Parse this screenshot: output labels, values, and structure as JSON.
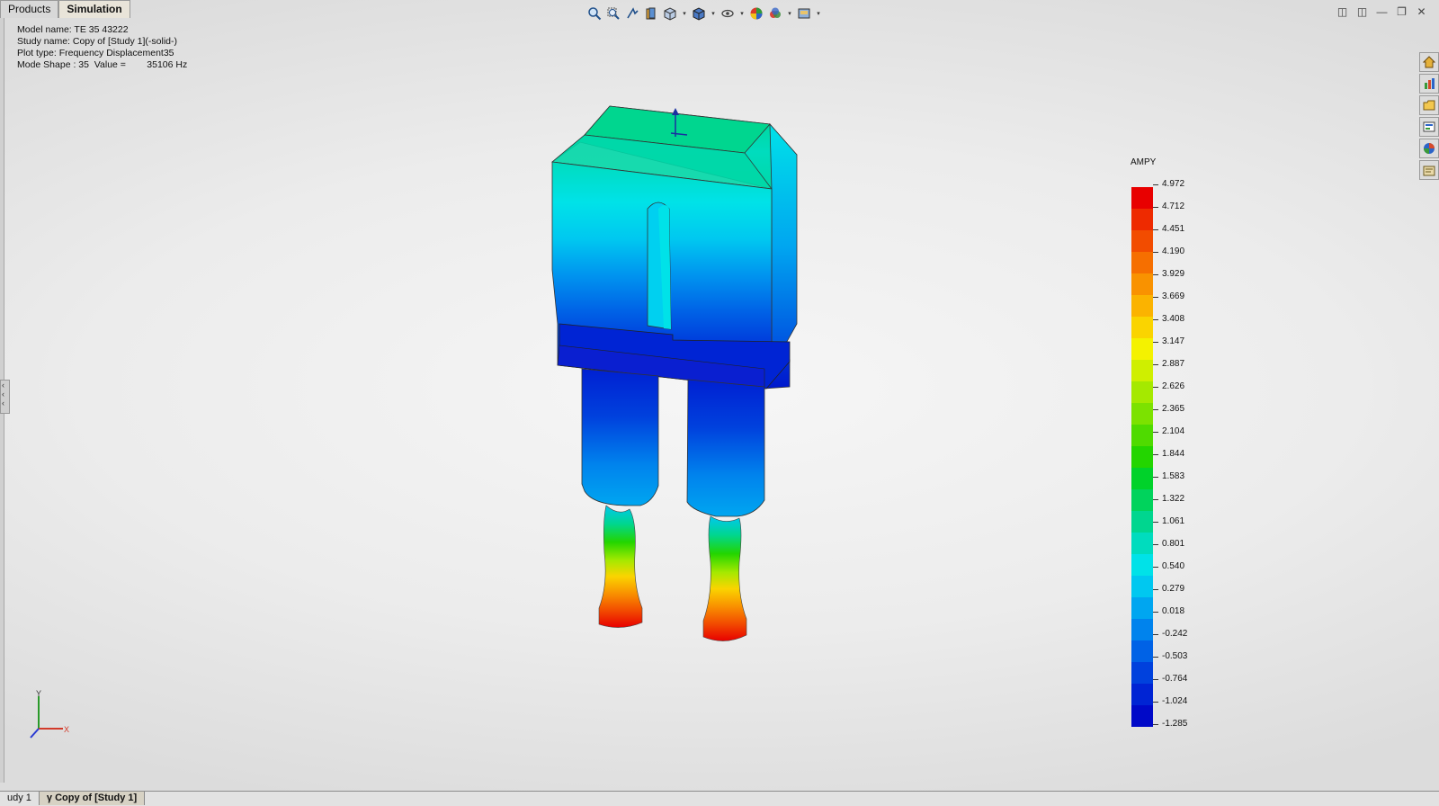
{
  "top_tabs": [
    "Products",
    "Simulation"
  ],
  "info": {
    "model_name": "Model name: TE 35 43222",
    "study_name": "Study name: Copy of [Study 1](-solid-)",
    "plot_type": "Plot type: Frequency Displacement35",
    "mode_shape": "Mode Shape : 35  Value =        35106 Hz"
  },
  "toolbar_icons": [
    "zoom-to-fit-icon",
    "zoom-area-icon",
    "previous-view-icon",
    "section-view-icon",
    "view-orientation-icon",
    "display-style-icon",
    "hide-show-items-icon",
    "edit-appearance-icon",
    "apply-scene-icon",
    "view-settings-icon"
  ],
  "window_controls": [
    "tile-horizontal-icon",
    "tile-vertical-icon",
    "restore-icon",
    "minimize-icon",
    "close-icon"
  ],
  "taskpane_icons": [
    "resources-icon",
    "design-library-icon",
    "file-explorer-icon",
    "view-palette-icon",
    "appearances-icon",
    "custom-properties-icon"
  ],
  "legend": {
    "title": "AMPY",
    "colors": [
      "#e80000",
      "#ee2a00",
      "#f24c00",
      "#f66f00",
      "#f99200",
      "#fbb300",
      "#fad400",
      "#f4f200",
      "#cfef00",
      "#a5e900",
      "#7ce200",
      "#4fdb00",
      "#23d500",
      "#00d22a",
      "#00d35c",
      "#00d68f",
      "#00dcbe",
      "#00e2e8",
      "#00c8f0",
      "#00a6f0",
      "#0083ed",
      "#0062e6",
      "#0041dd",
      "#0024d4",
      "#0009c8"
    ],
    "values": [
      "4.972",
      "4.712",
      "4.451",
      "4.190",
      "3.929",
      "3.669",
      "3.408",
      "3.147",
      "2.887",
      "2.626",
      "2.365",
      "2.104",
      "1.844",
      "1.583",
      "1.322",
      "1.061",
      "0.801",
      "0.540",
      "0.279",
      "0.018",
      "-0.242",
      "-0.503",
      "-0.764",
      "-1.024",
      "-1.285"
    ]
  },
  "triad": {
    "y_label": "Y",
    "x_label": "X"
  },
  "bottom_tabs": [
    "udy 1",
    "Copy of [Study 1]"
  ]
}
